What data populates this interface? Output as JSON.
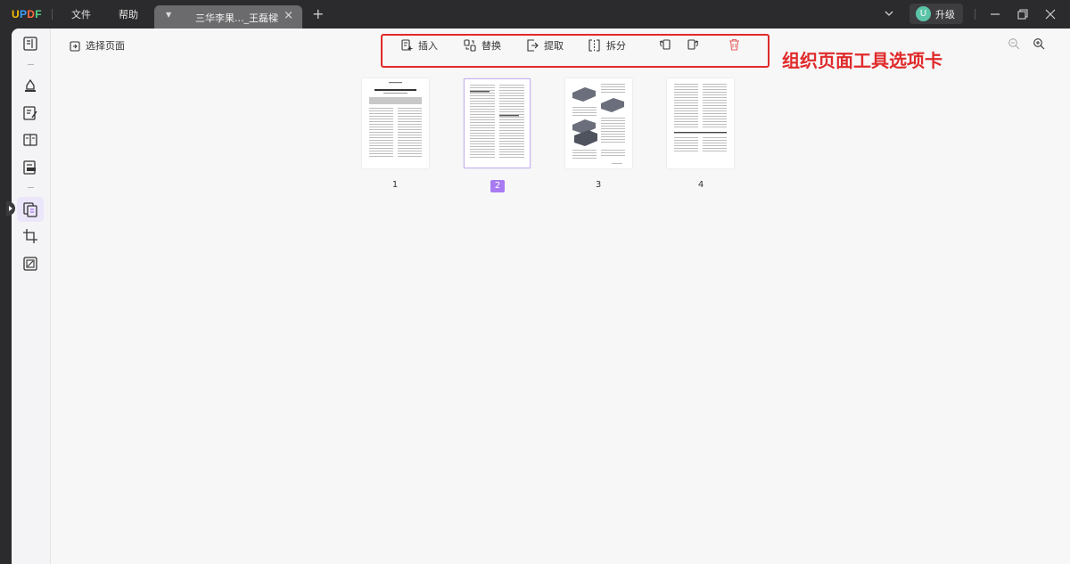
{
  "app": {
    "logo": "UPDF",
    "logo_colors": [
      "#f5c000",
      "#3aa0ff",
      "#ff6a3d",
      "#52d38a"
    ]
  },
  "menu": {
    "file": "文件",
    "help": "帮助"
  },
  "tab": {
    "title": "三华李果..._王磊樑"
  },
  "header_right": {
    "upgrade_label": "升级",
    "avatar_letter": "U"
  },
  "toolbar": {
    "select_pages": "选择页面",
    "insert": "插入",
    "replace": "替换",
    "extract": "提取",
    "split": "拆分"
  },
  "annotation": "组织页面工具选项卡",
  "pages": [
    {
      "number": "1",
      "selected": false
    },
    {
      "number": "2",
      "selected": true
    },
    {
      "number": "3",
      "selected": false
    },
    {
      "number": "4",
      "selected": false
    }
  ],
  "colors": {
    "accent": "#a97bf2",
    "highlight": "#e02a2a",
    "delete": "#e86060"
  }
}
